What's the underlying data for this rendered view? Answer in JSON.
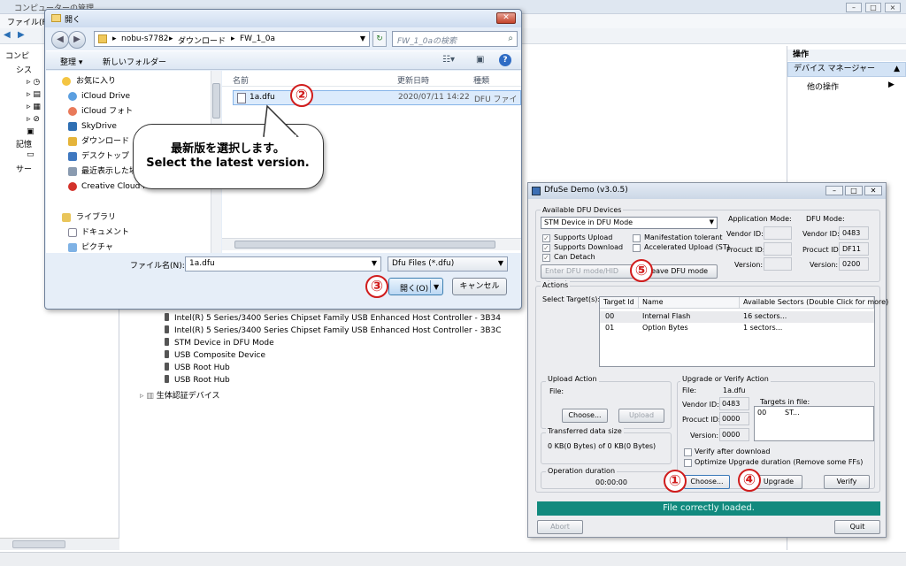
{
  "background": {
    "title": "コンピューターの管理",
    "menu": "ファイル(F",
    "tree": [
      "コンピ",
      "シス",
      "記憶",
      "サー"
    ],
    "devices": [
      "Intel(R) 5 Series/3400 Series Chipset Family USB Enhanced Host Controller - 3B34",
      "Intel(R) 5 Series/3400 Series Chipset Family USB Enhanced Host Controller - 3B3C",
      "STM Device in DFU Mode",
      "USB Composite Device",
      "USB Root Hub",
      "USB Root Hub"
    ],
    "biometric": "生体認証デバイス",
    "operations": {
      "header": "操作",
      "device_manager": "デバイス マネージャー",
      "other": "他の操作"
    }
  },
  "dialog": {
    "title": "開く",
    "breadcrumb": [
      "nobu-s7782",
      "ダウンロード",
      "FW_1_0a"
    ],
    "search_placeholder": "FW_1_0aの検索",
    "organize": "整理 ▾",
    "new_folder": "新しいフォルダー",
    "nav": {
      "favorites": "お気に入り",
      "items": [
        "iCloud Drive",
        "iCloud フォト",
        "SkyDrive",
        "ダウンロード",
        "デスクトップ",
        "最近表示した場",
        "Creative Cloud Files"
      ],
      "libraries": "ライブラリ",
      "lib_items": [
        "ドキュメント",
        "ピクチャ"
      ]
    },
    "columns": [
      "名前",
      "更新日時",
      "種類"
    ],
    "file": {
      "name": "1a.dfu",
      "date": "2020/07/11 14:22",
      "type": "DFU ファイ"
    },
    "filename_label": "ファイル名(N):",
    "filename_value": "1a.dfu",
    "filetype": "Dfu Files (*.dfu)",
    "open": "開く(O)",
    "cancel": "キャンセル"
  },
  "callout": {
    "line1": "最新版を選択します。",
    "line2": "Select the latest version."
  },
  "markers": [
    "①",
    "②",
    "③",
    "④",
    "⑤"
  ],
  "dfuse": {
    "title": "DfuSe Demo (v3.0.5)",
    "available": "Available DFU Devices",
    "device": "STM Device in DFU Mode",
    "checks": {
      "upload": "Supports Upload",
      "download": "Supports Download",
      "detach": "Can Detach",
      "manifest": "Manifestation tolerant",
      "accel": "Accelerated Upload (ST)"
    },
    "enter_dfu": "Enter DFU mode/HID detach",
    "leave_dfu": "Leave DFU mode",
    "app_mode": "Application Mode:",
    "dfu_mode": "DFU Mode:",
    "vendor_id": "Vendor ID:",
    "product_id": "Procuct ID:",
    "version": "Version:",
    "dfu_vendor": "0483",
    "dfu_product": "DF11",
    "dfu_version": "0200",
    "actions": "Actions",
    "select_targets": "Select Target(s):",
    "target_cols": [
      "Target Id",
      "Name",
      "Available Sectors (Double Click for more)"
    ],
    "targets": [
      {
        "id": "00",
        "name": "Internal Flash",
        "sectors": "16 sectors..."
      },
      {
        "id": "01",
        "name": "Option Bytes",
        "sectors": "1 sectors..."
      }
    ],
    "upload_action": "Upload Action",
    "file_label": "File:",
    "choose": "Choose...",
    "upload": "Upload",
    "transferred": "Transferred data size",
    "transferred_value": "0 KB(0 Bytes) of 0 KB(0 Bytes)",
    "op_duration": "Operation duration",
    "op_time": "00:00:00",
    "upgrade_verify": "Upgrade or Verify Action",
    "file_value": "1a.dfu",
    "up_vendor": "0483",
    "up_product": "0000",
    "up_version": "0000",
    "targets_in_file": "Targets in file:",
    "tif_row": [
      "00",
      "ST..."
    ],
    "verify_after": "Verify after download",
    "optimize": "Optimize Upgrade duration (Remove some FFs)",
    "choose2": "Choose...",
    "upgrade": "Upgrade",
    "verify": "Verify",
    "status": "File correctly loaded.",
    "abort": "Abort",
    "quit": "Quit"
  }
}
